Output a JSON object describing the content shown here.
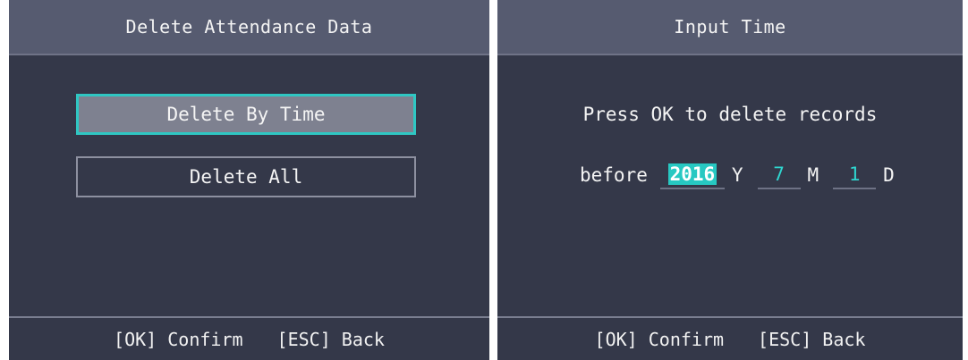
{
  "left_screen": {
    "title": "Delete Attendance Data",
    "menu": [
      {
        "label": "Delete By Time",
        "selected": true
      },
      {
        "label": "Delete All",
        "selected": false
      }
    ],
    "footer": {
      "ok": "[OK] Confirm",
      "esc": "[ESC] Back"
    }
  },
  "right_screen": {
    "title": "Input Time",
    "prompt": "Press OK to delete records",
    "before_label": "before",
    "year": "2016",
    "year_unit": "Y",
    "month": "7",
    "month_unit": "M",
    "day": "1",
    "day_unit": "D",
    "footer": {
      "ok": "[OK] Confirm",
      "esc": "[ESC] Back"
    }
  },
  "colors": {
    "background": "#343849",
    "title_bar": "#565b70",
    "accent": "#2fc7c3"
  }
}
